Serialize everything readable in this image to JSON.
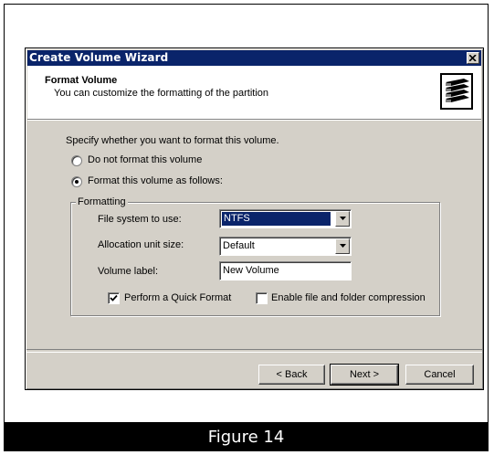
{
  "window": {
    "title": "Create Volume Wizard",
    "close_label": "×"
  },
  "header": {
    "title": "Format Volume",
    "subtitle": "You can customize the formatting of the partition",
    "icon": "disk-stack-icon"
  },
  "body": {
    "prompt": "Specify whether you want to format this volume.",
    "radio_no_format": "Do not format this volume",
    "radio_format": "Format this volume as follows:",
    "selected_option": "Format this volume as follows:"
  },
  "formatting": {
    "legend": "Formatting",
    "fs_label": "File system to use:",
    "fs_value": "NTFS",
    "alloc_label": "Allocation unit size:",
    "alloc_value": "Default",
    "volume_label": "Volume label:",
    "volume_value": "New Volume",
    "quick_format_label": "Perform a Quick Format",
    "quick_format_checked": true,
    "compression_label": "Enable file and folder compression",
    "compression_checked": false
  },
  "buttons": {
    "back": "< Back",
    "next": "Next >",
    "cancel": "Cancel"
  },
  "caption": "Figure 14",
  "colors": {
    "titlebar": "#0a246a",
    "dialog": "#d4d0c8",
    "caption_bar": "#000000"
  }
}
